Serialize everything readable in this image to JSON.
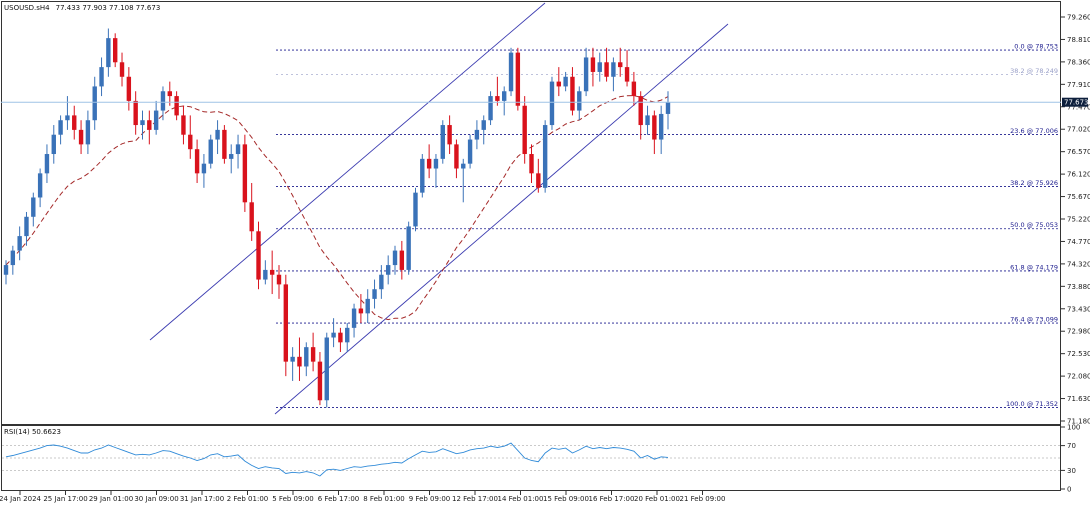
{
  "header": {
    "symbol": "USOUSD.sH4",
    "ohlc": "77.433 77.903 77.108 77.673"
  },
  "current_price": "77.673",
  "rsi_label": "RSI(14) 50.6623",
  "colors": {
    "up": "#3a72b8",
    "down": "#d9121c",
    "ma": "#a52a2a",
    "channel": "#3b3bb0",
    "fib": "#1a1a8c",
    "rsi": "#2f8ad8",
    "price_tag_bg": "#0d1f3c"
  },
  "chart_data": {
    "type": "candlestick",
    "title": "USOUSD.sH4",
    "y_ticks": [
      "79.260",
      "78.810",
      "78.360",
      "77.910",
      "77.470",
      "77.020",
      "76.570",
      "76.120",
      "75.670",
      "75.220",
      "74.770",
      "74.320",
      "73.880",
      "73.430",
      "72.980",
      "72.530",
      "72.080",
      "71.630",
      "71.180"
    ],
    "x_ticks": [
      "24 Jan 2024",
      "25 Jan 17:00",
      "29 Jan 01:00",
      "30 Jan 09:00",
      "31 Jan 17:00",
      "2 Feb 01:00",
      "5 Feb 09:00",
      "6 Feb 17:00",
      "8 Feb 01:00",
      "9 Feb 09:00",
      "12 Feb 17:00",
      "14 Feb 01:00",
      "15 Feb 09:00",
      "16 Feb 17:00",
      "20 Feb 01:00",
      "21 Feb 09:00"
    ],
    "ylim": [
      71.05,
      79.5
    ],
    "candles": [
      [
        74.1,
        74.4,
        73.9,
        74.3
      ],
      [
        74.3,
        74.7,
        74.1,
        74.6
      ],
      [
        74.6,
        75.1,
        74.4,
        74.9
      ],
      [
        74.9,
        75.4,
        74.7,
        75.3
      ],
      [
        75.3,
        75.8,
        75.1,
        75.7
      ],
      [
        75.7,
        76.3,
        75.5,
        76.2
      ],
      [
        76.2,
        76.8,
        76.0,
        76.6
      ],
      [
        76.6,
        77.2,
        76.4,
        77.0
      ],
      [
        77.0,
        77.4,
        76.8,
        77.3
      ],
      [
        77.3,
        77.8,
        77.1,
        77.4
      ],
      [
        77.4,
        77.6,
        76.9,
        77.1
      ],
      [
        77.1,
        77.3,
        76.6,
        76.8
      ],
      [
        76.8,
        77.5,
        76.6,
        77.3
      ],
      [
        77.3,
        78.2,
        77.1,
        78.0
      ],
      [
        78.0,
        78.6,
        77.8,
        78.4
      ],
      [
        78.4,
        79.2,
        78.2,
        79.0
      ],
      [
        79.0,
        79.1,
        78.4,
        78.5
      ],
      [
        78.5,
        78.7,
        78.0,
        78.2
      ],
      [
        78.2,
        78.4,
        77.5,
        77.7
      ],
      [
        77.7,
        77.9,
        77.0,
        77.2
      ],
      [
        77.2,
        77.5,
        76.9,
        77.3
      ],
      [
        77.3,
        77.5,
        76.8,
        77.1
      ],
      [
        77.1,
        77.7,
        77.0,
        77.5
      ],
      [
        77.5,
        78.0,
        77.3,
        77.9
      ],
      [
        77.9,
        78.1,
        77.6,
        77.8
      ],
      [
        77.8,
        77.9,
        77.3,
        77.4
      ],
      [
        77.4,
        77.6,
        76.8,
        77.0
      ],
      [
        77.0,
        77.4,
        76.5,
        76.7
      ],
      [
        76.7,
        76.9,
        76.0,
        76.2
      ],
      [
        76.2,
        76.6,
        75.9,
        76.4
      ],
      [
        76.4,
        77.0,
        76.3,
        76.9
      ],
      [
        76.9,
        77.3,
        76.6,
        77.1
      ],
      [
        77.1,
        77.2,
        76.4,
        76.5
      ],
      [
        76.5,
        76.8,
        76.2,
        76.6
      ],
      [
        76.6,
        77.0,
        76.3,
        76.8
      ],
      [
        76.8,
        77.0,
        75.4,
        75.6
      ],
      [
        75.6,
        76.0,
        74.8,
        75.0
      ],
      [
        75.0,
        75.2,
        73.8,
        74.0
      ],
      [
        74.0,
        74.4,
        73.9,
        74.2
      ],
      [
        74.2,
        74.6,
        73.7,
        74.1
      ],
      [
        74.1,
        74.3,
        73.6,
        73.9
      ],
      [
        73.9,
        74.1,
        72.0,
        72.3
      ],
      [
        72.3,
        72.6,
        71.9,
        72.4
      ],
      [
        72.4,
        72.8,
        71.9,
        72.2
      ],
      [
        72.2,
        72.7,
        72.0,
        72.6
      ],
      [
        72.6,
        72.9,
        72.1,
        72.3
      ],
      [
        72.3,
        72.5,
        71.4,
        71.5
      ],
      [
        71.5,
        72.9,
        71.35,
        72.8
      ],
      [
        72.8,
        73.2,
        72.6,
        72.9
      ],
      [
        72.9,
        73.0,
        72.5,
        72.7
      ],
      [
        72.7,
        73.1,
        72.5,
        73.0
      ],
      [
        73.0,
        73.5,
        72.8,
        73.4
      ],
      [
        73.4,
        73.7,
        73.1,
        73.3
      ],
      [
        73.3,
        73.8,
        73.1,
        73.6
      ],
      [
        73.6,
        74.0,
        73.4,
        73.8
      ],
      [
        73.8,
        74.3,
        73.6,
        74.1
      ],
      [
        74.1,
        74.5,
        73.9,
        74.3
      ],
      [
        74.3,
        74.7,
        74.1,
        74.6
      ],
      [
        74.6,
        74.8,
        74.0,
        74.2
      ],
      [
        74.2,
        75.2,
        74.1,
        75.1
      ],
      [
        75.1,
        75.9,
        75.0,
        75.8
      ],
      [
        75.8,
        76.6,
        75.7,
        76.5
      ],
      [
        76.5,
        76.8,
        76.1,
        76.3
      ],
      [
        76.3,
        76.6,
        75.9,
        76.5
      ],
      [
        76.5,
        77.3,
        76.4,
        77.2
      ],
      [
        77.2,
        77.4,
        76.6,
        76.8
      ],
      [
        76.8,
        76.9,
        76.1,
        76.3
      ],
      [
        76.3,
        76.5,
        75.6,
        76.4
      ],
      [
        76.4,
        77.0,
        76.3,
        76.9
      ],
      [
        76.9,
        77.3,
        76.7,
        77.1
      ],
      [
        77.1,
        77.4,
        76.8,
        77.3
      ],
      [
        77.3,
        77.9,
        77.2,
        77.8
      ],
      [
        77.8,
        78.2,
        77.6,
        77.7
      ],
      [
        77.7,
        78.0,
        77.4,
        77.9
      ],
      [
        77.9,
        78.8,
        77.8,
        78.7
      ],
      [
        78.7,
        78.8,
        77.5,
        77.6
      ],
      [
        77.6,
        77.8,
        76.4,
        76.6
      ],
      [
        76.6,
        76.8,
        76.0,
        76.2
      ],
      [
        76.2,
        76.5,
        75.8,
        75.9
      ],
      [
        75.9,
        77.3,
        75.8,
        77.2
      ],
      [
        77.2,
        78.2,
        77.1,
        78.1
      ],
      [
        78.1,
        78.4,
        77.8,
        78.0
      ],
      [
        78.0,
        78.3,
        77.9,
        78.2
      ],
      [
        78.2,
        78.4,
        77.4,
        77.5
      ],
      [
        77.5,
        78.0,
        77.3,
        77.9
      ],
      [
        77.9,
        78.8,
        77.8,
        78.6
      ],
      [
        78.6,
        78.8,
        78.0,
        78.3
      ],
      [
        78.3,
        78.7,
        78.1,
        78.5
      ],
      [
        78.5,
        78.8,
        78.1,
        78.2
      ],
      [
        78.2,
        78.6,
        77.9,
        78.5
      ],
      [
        78.5,
        78.8,
        78.2,
        78.4
      ],
      [
        78.4,
        78.75,
        78.0,
        78.1
      ],
      [
        78.1,
        78.3,
        77.6,
        77.8
      ],
      [
        77.8,
        77.9,
        76.9,
        77.2
      ],
      [
        77.2,
        77.6,
        77.0,
        77.4
      ],
      [
        77.4,
        77.5,
        76.6,
        76.9
      ],
      [
        76.9,
        77.6,
        76.6,
        77.43
      ],
      [
        77.43,
        77.9,
        77.11,
        77.67
      ]
    ],
    "fib_levels": [
      {
        "label": "0.0 @ 78.753",
        "value": 78.753,
        "style": "strong"
      },
      {
        "label": "38.2 @ 78.249",
        "value": 78.249,
        "style": "faint"
      },
      {
        "label": "23.6 @ 77.006",
        "value": 77.006,
        "style": "strong"
      },
      {
        "label": "38.2 @ 75.926",
        "value": 75.926,
        "style": "strong"
      },
      {
        "label": "50.0 @ 75.053",
        "value": 75.053,
        "style": "strong"
      },
      {
        "label": "61.8 @ 74.179",
        "value": 74.179,
        "style": "strong"
      },
      {
        "label": "76.4 @ 73.099",
        "value": 73.099,
        "style": "strong"
      },
      {
        "label": "100.0 @ 71.352",
        "value": 71.352,
        "style": "strong"
      }
    ],
    "rsi": {
      "levels": [
        70,
        50,
        30
      ],
      "y_ticks": [
        "100",
        "70",
        "30",
        "0"
      ],
      "values": [
        52,
        54,
        57,
        60,
        63,
        66,
        70,
        71,
        69,
        66,
        62,
        58,
        58,
        63,
        66,
        71,
        67,
        63,
        59,
        55,
        56,
        55,
        58,
        62,
        61,
        57,
        53,
        50,
        46,
        49,
        55,
        57,
        52,
        53,
        55,
        45,
        38,
        33,
        36,
        34,
        33,
        25,
        27,
        26,
        28,
        26,
        21,
        31,
        32,
        30,
        33,
        36,
        35,
        37,
        38,
        40,
        41,
        43,
        42,
        49,
        55,
        61,
        59,
        60,
        65,
        61,
        57,
        59,
        63,
        65,
        66,
        69,
        67,
        69,
        74,
        62,
        50,
        46,
        44,
        58,
        66,
        64,
        66,
        58,
        63,
        69,
        65,
        67,
        65,
        67,
        66,
        64,
        61,
        50,
        54,
        48,
        52,
        51
      ]
    }
  }
}
